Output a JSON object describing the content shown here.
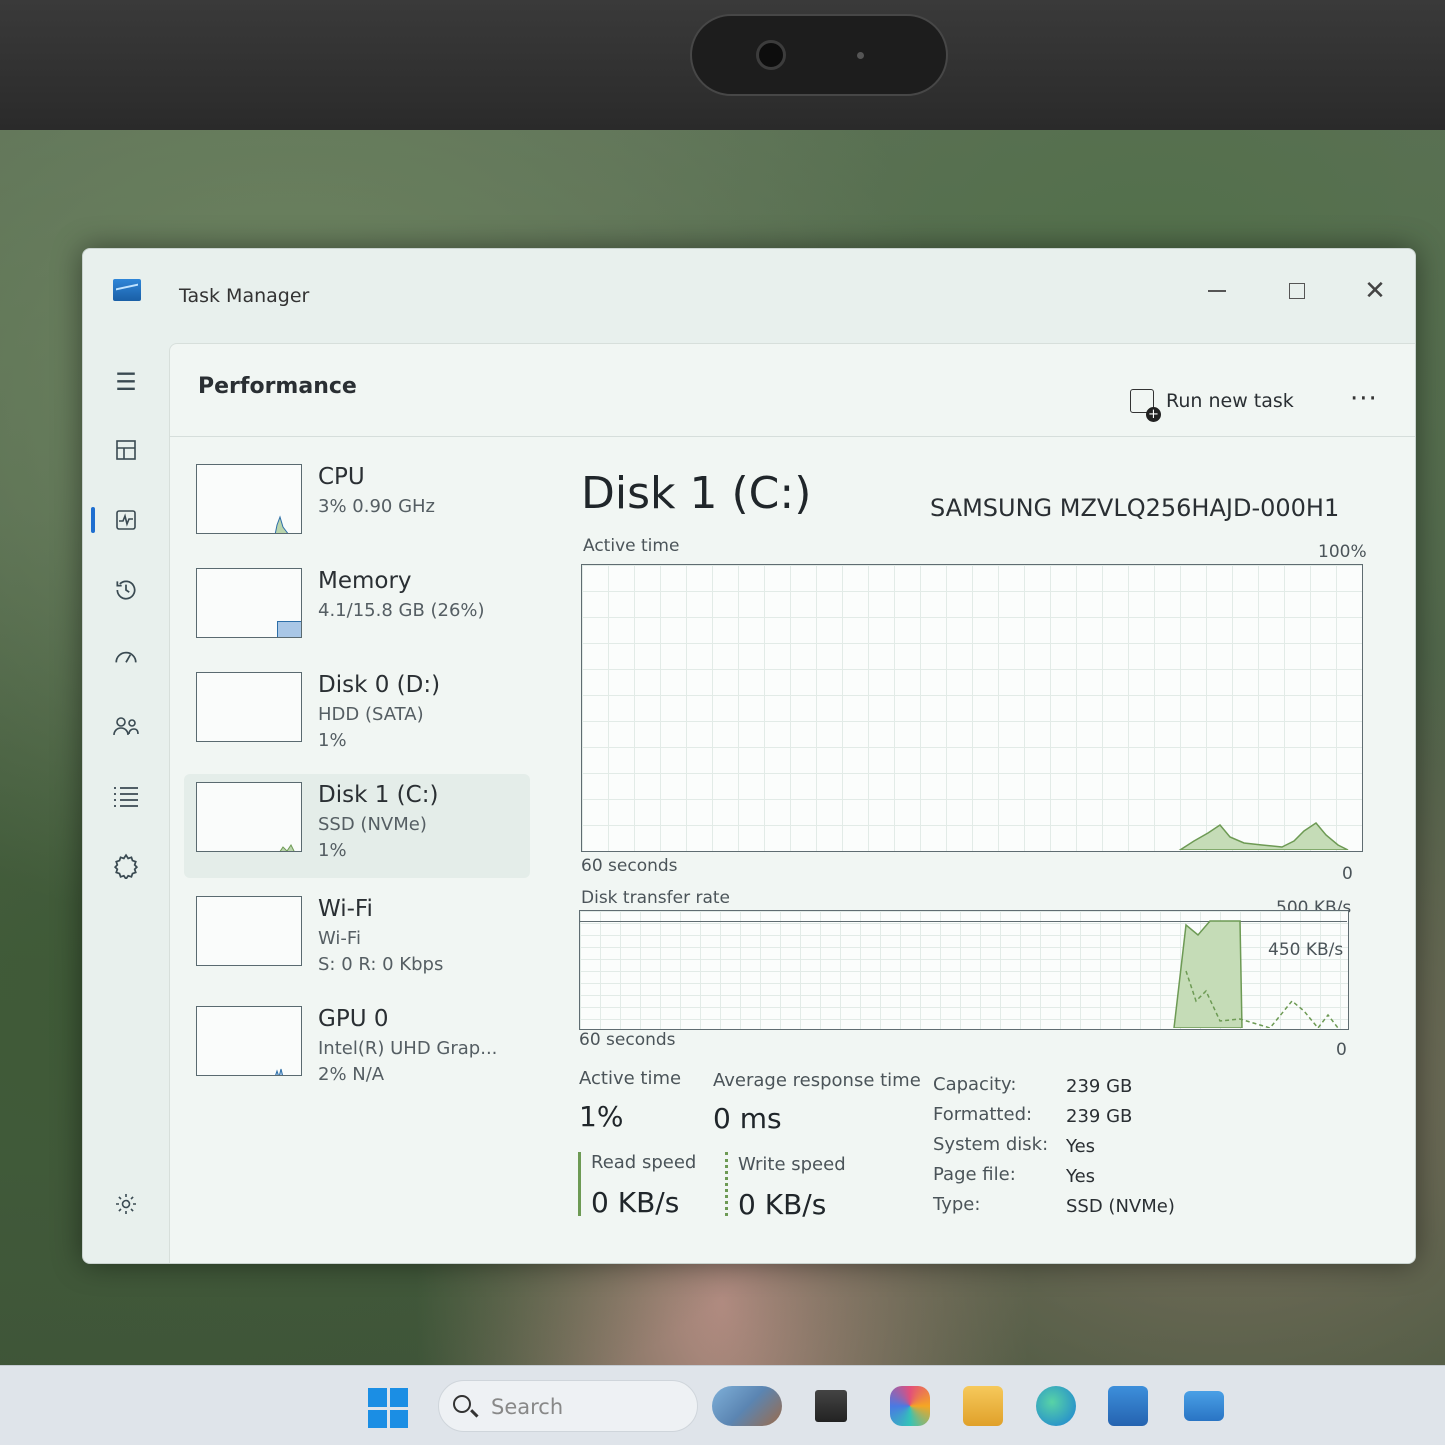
{
  "window": {
    "title": "Task Manager"
  },
  "header": {
    "page_title": "Performance",
    "run_new_task": "Run new task",
    "more": "···"
  },
  "devices": [
    {
      "name": "CPU",
      "line1": "3%  0.90 GHz",
      "line2": ""
    },
    {
      "name": "Memory",
      "line1": "4.1/15.8 GB (26%)",
      "line2": ""
    },
    {
      "name": "Disk 0 (D:)",
      "line1": "HDD (SATA)",
      "line2": "1%"
    },
    {
      "name": "Disk 1 (C:)",
      "line1": "SSD (NVMe)",
      "line2": "1%"
    },
    {
      "name": "Wi-Fi",
      "line1": "Wi-Fi",
      "line2": "S: 0 R: 0 Kbps"
    },
    {
      "name": "GPU 0",
      "line1": "Intel(R) UHD Grap...",
      "line2": "2%  N/A"
    }
  ],
  "detail": {
    "title": "Disk 1 (C:)",
    "model": "SAMSUNG MZVLQ256HAJD-000H1",
    "active_graph": {
      "label": "Active time",
      "max": "100%",
      "min": "0",
      "duration": "60 seconds"
    },
    "transfer_graph": {
      "label": "Disk transfer rate",
      "max": "500 KB/s",
      "mid": "450 KB/s",
      "min": "0",
      "duration": "60 seconds"
    },
    "stats": {
      "active_time_label": "Active time",
      "active_time_value": "1%",
      "response_label": "Average response time",
      "response_value": "0 ms",
      "read_label": "Read speed",
      "read_value": "0 KB/s",
      "write_label": "Write speed",
      "write_value": "0 KB/s"
    },
    "properties": [
      {
        "label": "Capacity:",
        "value": "239 GB"
      },
      {
        "label": "Formatted:",
        "value": "239 GB"
      },
      {
        "label": "System disk:",
        "value": "Yes"
      },
      {
        "label": "Page file:",
        "value": "Yes"
      },
      {
        "label": "Type:",
        "value": "SSD (NVMe)"
      }
    ]
  },
  "taskbar": {
    "search_placeholder": "Search"
  },
  "colors": {
    "accent": "#1f6fd0",
    "graph_line": "#6d9a54",
    "graph_fill": "#b9d4ac"
  }
}
